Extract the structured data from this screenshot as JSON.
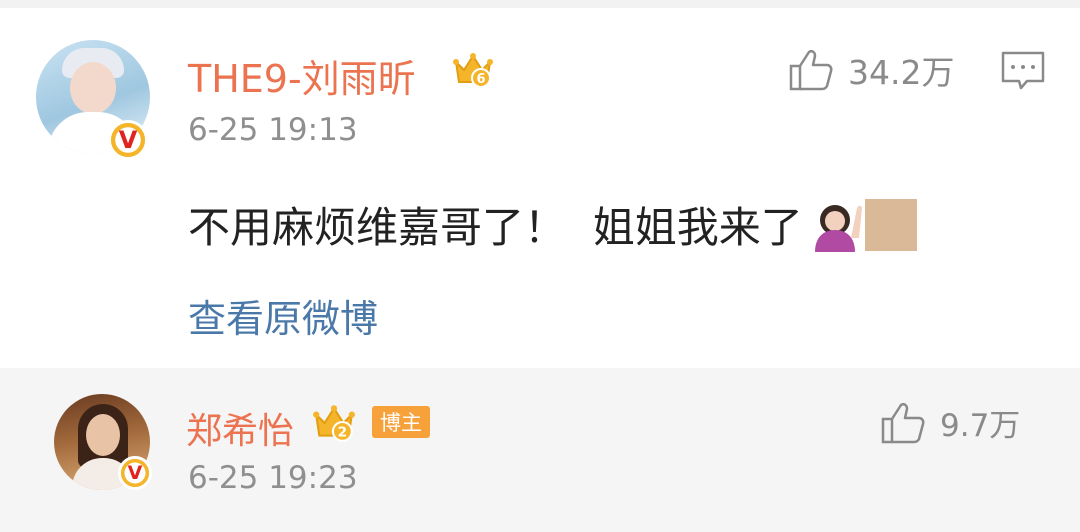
{
  "comments": [
    {
      "username": "THE9-刘雨昕",
      "crown_level": "6",
      "verified_badge": "V",
      "time": "6-25 19:13",
      "likes": "34.2万",
      "text": "不用麻烦维嘉哥了！  姐姐我来了",
      "emoji": [
        "person-raising-hand-emoji",
        "skin-tone-modifier"
      ],
      "view_original": "查看原微博"
    },
    {
      "username": "郑希怡",
      "crown_level": "2",
      "verified_badge": "V",
      "tag": "博主",
      "time": "6-25 19:23",
      "likes": "9.7万"
    }
  ],
  "colors": {
    "username": "#eb7350",
    "timestamp": "#8f8f8f",
    "link": "#4a78a8",
    "crown": "#f4b52a",
    "tag_background": "#f7a13b"
  }
}
